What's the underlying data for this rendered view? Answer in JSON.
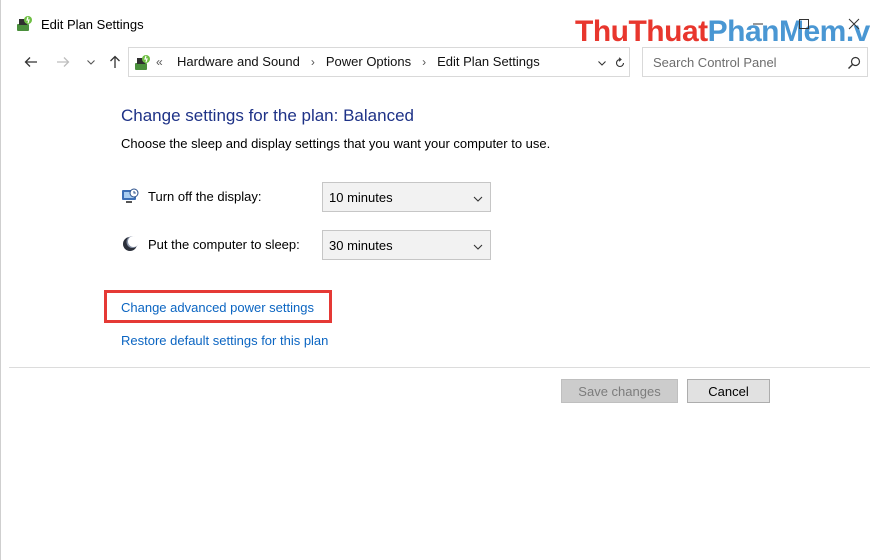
{
  "window": {
    "title": "Edit Plan Settings",
    "watermark_part1": "ThuThuat",
    "watermark_part2": "PhanMem.vn"
  },
  "navigation": {
    "back_icon": "arrow-left-icon",
    "forward_icon": "arrow-right-icon",
    "recent_icon": "chevron-down-icon",
    "up_icon": "arrow-up-icon",
    "overflow": "«",
    "breadcrumbs": [
      "Hardware and Sound",
      "Power Options",
      "Edit Plan Settings"
    ],
    "search_placeholder": "Search Control Panel"
  },
  "content": {
    "heading": "Change settings for the plan: Balanced",
    "subtitle": "Choose the sleep and display settings that you want your computer to use.",
    "display_label": "Turn off the display:",
    "display_value": "10 minutes",
    "sleep_label": "Put the computer to sleep:",
    "sleep_value": "30 minutes",
    "advanced_link": "Change advanced power settings",
    "restore_link": "Restore default settings for this plan"
  },
  "buttons": {
    "save": "Save changes",
    "cancel": "Cancel"
  },
  "colors": {
    "heading": "#1e3287",
    "link": "#0b65c2",
    "highlight": "#e53935",
    "watermark_red": "#e8362d",
    "watermark_blue": "#3b8fd0"
  }
}
